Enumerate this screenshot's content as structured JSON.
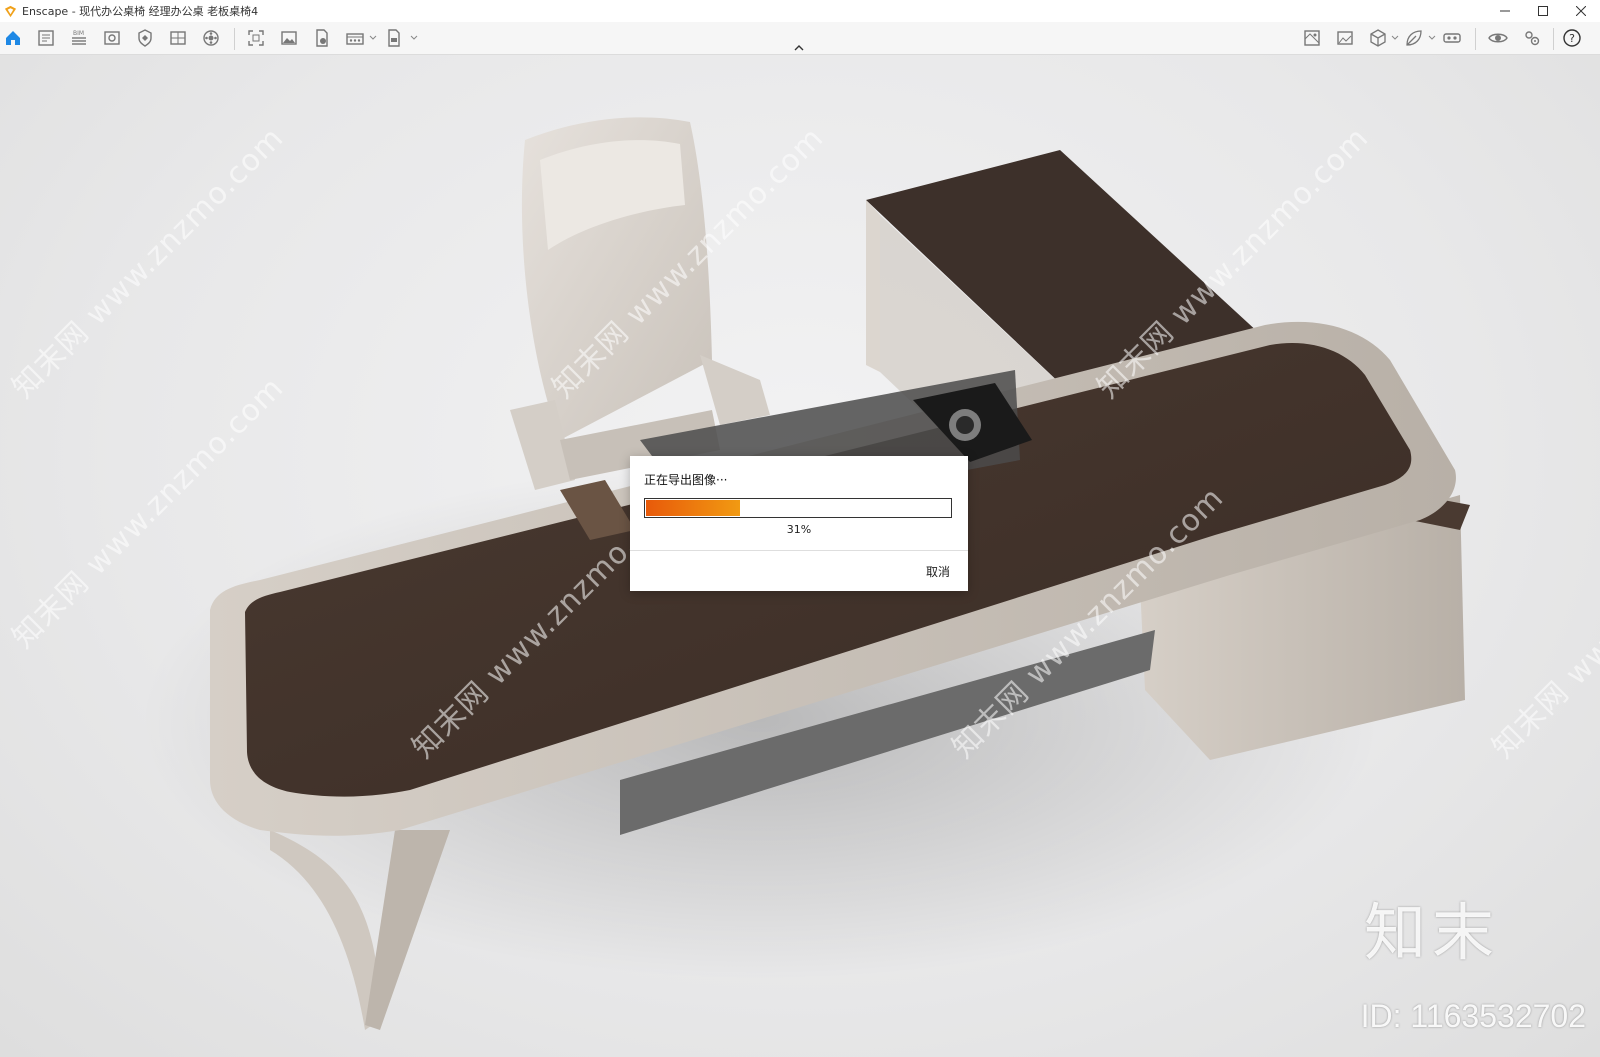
{
  "window": {
    "title": "Enscape - 现代办公桌椅 经理办公桌 老板桌椅4",
    "minimize_icon": "minimize-icon",
    "maximize_icon": "maximize-icon",
    "close_icon": "close-icon"
  },
  "toolbar": {
    "left_icons": [
      "home-icon",
      "document-icon",
      "bim-icon",
      "view-icon",
      "shield-icon",
      "panel-icon",
      "asset-library-icon",
      "screenshot-icon",
      "image-icon",
      "export-file-icon",
      "batch-render-icon",
      "exe-export-icon"
    ],
    "right_icons": [
      "settings-map-icon",
      "image-export-icon",
      "cube-icon",
      "leaf-icon",
      "vr-headset-icon",
      "visibility-icon",
      "settings-icon",
      "help-icon"
    ],
    "help_label": "?",
    "bim_label": "BIM"
  },
  "dialog": {
    "title": "正在导出图像···",
    "progress": 0.31,
    "percent_text": "31%",
    "cancel_label": "取消"
  },
  "watermarks": {
    "diagonal_text": "知末网 www.znzmo.com",
    "logo_text": "知末",
    "id_text": "ID: 1163532702"
  },
  "colors": {
    "accent": "#e85a0a",
    "accent_end": "#f19a12",
    "desk_wood": "#3f3129",
    "desk_frame": "#cbc3bb",
    "chair": "#d9d3cc"
  }
}
